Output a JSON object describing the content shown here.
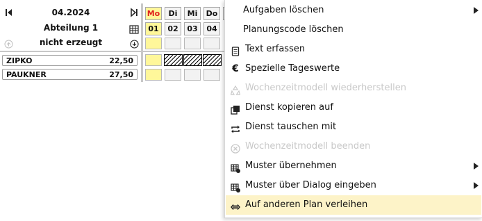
{
  "header": {
    "month": "04.2024",
    "department": "Abteilung 1",
    "status": "nicht erzeugt"
  },
  "days": [
    {
      "weekday": "Mo",
      "date": "01"
    },
    {
      "weekday": "Di",
      "date": "02"
    },
    {
      "weekday": "Mi",
      "date": "03"
    },
    {
      "weekday": "Do",
      "date": "04"
    }
  ],
  "employees": [
    {
      "name": "ZIPKO",
      "value": "22,50"
    },
    {
      "name": "PAUKNER",
      "value": "27,50"
    }
  ],
  "menu": {
    "items": [
      {
        "label": "Aufgaben löschen",
        "icon": "",
        "disabled": false,
        "submenu": true
      },
      {
        "label": "Planungscode löschen",
        "icon": "",
        "disabled": false,
        "submenu": false
      },
      {
        "label": "Text erfassen",
        "icon": "document-icon",
        "disabled": false,
        "submenu": false
      },
      {
        "label": "Spezielle Tageswerte",
        "icon": "euro-icon",
        "disabled": false,
        "submenu": false
      },
      {
        "label": "Wochenzeitmodell wiederherstellen",
        "icon": "recycle-icon",
        "disabled": true,
        "submenu": false
      },
      {
        "label": "Dienst kopieren auf",
        "icon": "copy-icon",
        "disabled": false,
        "submenu": false
      },
      {
        "label": "Dienst tauschen mit",
        "icon": "swap-icon",
        "disabled": false,
        "submenu": false
      },
      {
        "label": "Wochenzeitmodell beenden",
        "icon": "cancel-circle-icon",
        "disabled": true,
        "submenu": false
      },
      {
        "label": "Muster übernehmen",
        "icon": "pattern-icon",
        "disabled": false,
        "submenu": true
      },
      {
        "label": "Muster über Dialog eingeben",
        "icon": "pattern-icon",
        "disabled": false,
        "submenu": true
      },
      {
        "label": "Auf anderen Plan verleihen",
        "icon": "transfer-arrows-icon",
        "disabled": false,
        "submenu": false,
        "highlighted": true
      }
    ]
  },
  "colors": {
    "today_fill": "#fff79a",
    "today_text": "#e0201c",
    "menu_highlight": "#fdf3c8",
    "disabled_text": "#c8c8c8"
  }
}
